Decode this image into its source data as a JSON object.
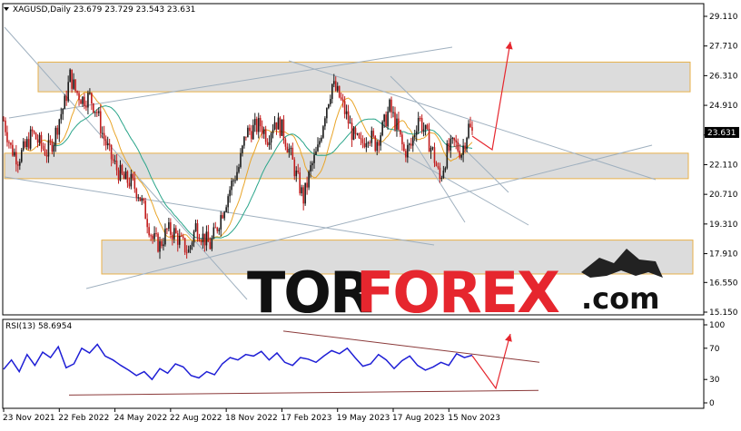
{
  "chart_data": [
    {
      "type": "candlestick",
      "symbol": "XAGUSD,Daily",
      "ohlc_header": "23.679 23.729 23.543 23.631",
      "last_price_label": "23.631",
      "price_ticks": [
        "29.110",
        "27.710",
        "26.310",
        "24.910",
        "23.510",
        "22.110",
        "20.710",
        "19.310",
        "17.910",
        "16.550",
        "15.150"
      ],
      "price_tick_values": [
        29.11,
        27.71,
        26.31,
        24.91,
        23.51,
        22.11,
        20.71,
        19.31,
        17.91,
        16.55,
        15.15
      ],
      "ylim": [
        15.15,
        29.11
      ],
      "date_labels": [
        "23 Nov 2021",
        "22 Feb 2022",
        "24 May 2022",
        "22 Aug 2022",
        "18 Nov 2022",
        "17 Feb 2023",
        "19 May 2023",
        "17 Aug 2023",
        "15 Nov 2023"
      ],
      "date_label_x": [
        0,
        62,
        124,
        186,
        248,
        310,
        372,
        434,
        496
      ],
      "close_path": [
        [
          0,
          24.2
        ],
        [
          8,
          22.9
        ],
        [
          16,
          22.4
        ],
        [
          24,
          22.9
        ],
        [
          32,
          23.6
        ],
        [
          40,
          23.1
        ],
        [
          48,
          22.7
        ],
        [
          56,
          23.3
        ],
        [
          62,
          24.3
        ],
        [
          68,
          25.0
        ],
        [
          74,
          26.3
        ],
        [
          80,
          25.6
        ],
        [
          88,
          25.2
        ],
        [
          96,
          25.3
        ],
        [
          104,
          24.6
        ],
        [
          110,
          23.6
        ],
        [
          118,
          22.6
        ],
        [
          126,
          21.9
        ],
        [
          134,
          21.4
        ],
        [
          142,
          21.3
        ],
        [
          150,
          20.8
        ],
        [
          158,
          19.8
        ],
        [
          166,
          18.6
        ],
        [
          174,
          18.3
        ],
        [
          182,
          19.0
        ],
        [
          190,
          18.9
        ],
        [
          198,
          18.4
        ],
        [
          206,
          18.0
        ],
        [
          214,
          19.2
        ],
        [
          222,
          18.7
        ],
        [
          230,
          18.3
        ],
        [
          238,
          19.2
        ],
        [
          246,
          20.2
        ],
        [
          254,
          21.2
        ],
        [
          262,
          22.0
        ],
        [
          270,
          23.6
        ],
        [
          278,
          23.8
        ],
        [
          286,
          24.0
        ],
        [
          294,
          23.4
        ],
        [
          302,
          24.2
        ],
        [
          310,
          23.8
        ],
        [
          318,
          22.8
        ],
        [
          326,
          21.6
        ],
        [
          334,
          20.5
        ],
        [
          342,
          21.9
        ],
        [
          350,
          22.8
        ],
        [
          358,
          24.6
        ],
        [
          366,
          25.9
        ],
        [
          374,
          25.3
        ],
        [
          382,
          24.4
        ],
        [
          390,
          23.4
        ],
        [
          398,
          23.0
        ],
        [
          406,
          23.6
        ],
        [
          414,
          23.1
        ],
        [
          422,
          23.8
        ],
        [
          430,
          24.8
        ],
        [
          438,
          23.9
        ],
        [
          446,
          22.7
        ],
        [
          454,
          23.0
        ],
        [
          462,
          24.4
        ],
        [
          470,
          23.6
        ],
        [
          478,
          22.7
        ],
        [
          486,
          21.4
        ],
        [
          494,
          22.7
        ],
        [
          502,
          23.1
        ],
        [
          510,
          22.7
        ],
        [
          518,
          23.9
        ],
        [
          522,
          23.6
        ]
      ],
      "support_resistance_zones": [
        [
          25.55,
          26.95
        ],
        [
          21.45,
          22.65
        ],
        [
          16.95,
          18.55
        ]
      ]
    },
    {
      "type": "line",
      "indicator_label": "RSI(13) 58.6954",
      "ylim": [
        0,
        100
      ],
      "rsi_ticks": [
        "100",
        "70",
        "30",
        "0"
      ],
      "rsi_tick_values": [
        100,
        70,
        30,
        0
      ],
      "values": [
        43,
        55,
        40,
        62,
        48,
        65,
        58,
        72,
        45,
        50,
        70,
        64,
        75,
        60,
        55,
        48,
        42,
        35,
        40,
        30,
        44,
        38,
        50,
        46,
        35,
        32,
        40,
        36,
        50,
        58,
        55,
        62,
        60,
        66,
        55,
        64,
        52,
        48,
        58,
        56,
        52,
        60,
        67,
        63,
        70,
        58,
        47,
        50,
        62,
        55,
        44,
        54,
        60,
        48,
        42,
        46,
        52,
        48,
        63,
        58,
        61
      ]
    }
  ],
  "watermark": {
    "part1": "TOR",
    "part2": "FOREX",
    "part3": ".com"
  },
  "colors": {
    "bull_candle": "#1a1a1a",
    "bear_candle": "#c21d1d",
    "ma_fast": "#e9a52a",
    "ma_slow": "#2aa58a",
    "rsi_line": "#1f1fd6",
    "arrow": "#e6262e",
    "trendline": "#9fb0bf"
  }
}
